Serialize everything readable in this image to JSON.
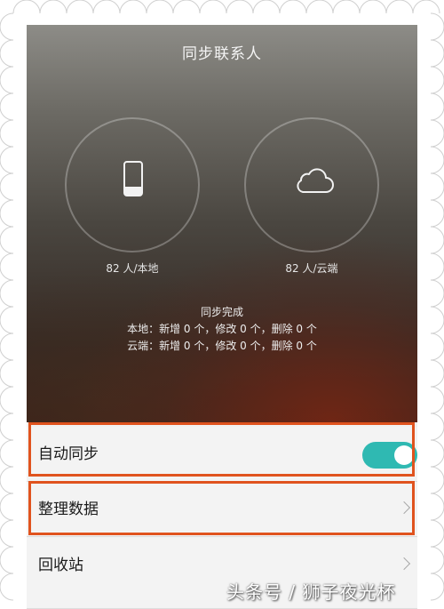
{
  "header": {
    "title": "同步联系人"
  },
  "sources": [
    {
      "icon": "phone-icon",
      "count_label": "82 人/本地"
    },
    {
      "icon": "cloud-icon",
      "count_label": "82 人/云端"
    }
  ],
  "status": {
    "title": "同步完成",
    "local_line": "本地：新增 0 个，修改 0 个，删除 0 个",
    "cloud_line": "云端：新增 0 个，修改 0 个，删除 0 个"
  },
  "settings": {
    "auto_sync": {
      "label": "自动同步",
      "enabled": true
    },
    "organize_data": {
      "label": "整理数据"
    },
    "recycle_bin": {
      "label": "回收站"
    }
  },
  "colors": {
    "accent_toggle": "#2fb9b2",
    "highlight_border": "#e0531e"
  },
  "watermark": "头条号 / 狮子夜光杯"
}
